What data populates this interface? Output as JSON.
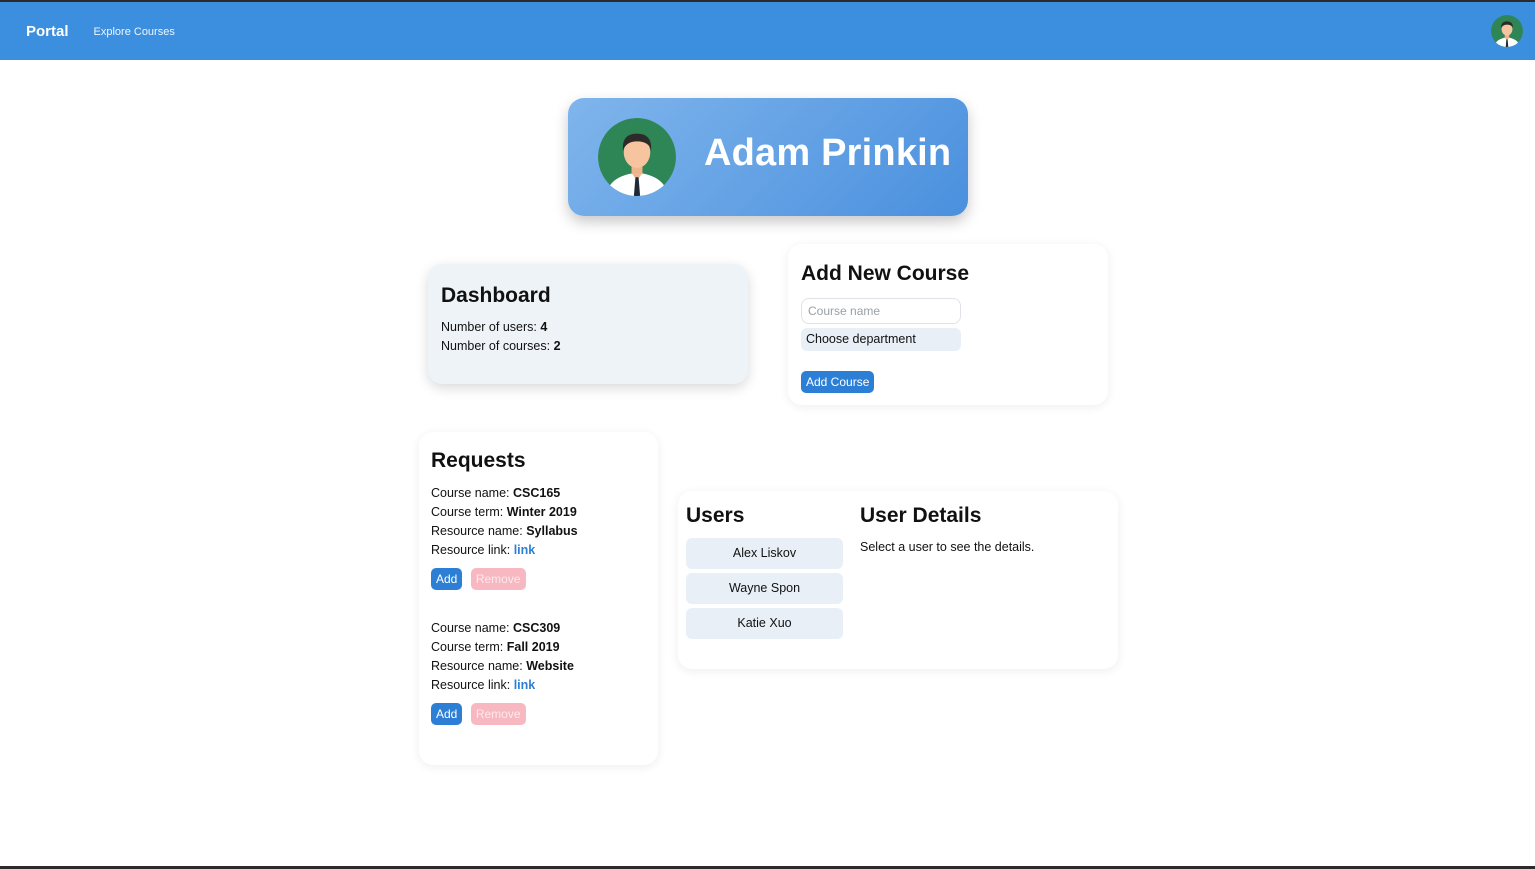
{
  "nav": {
    "brand": "Portal",
    "links": [
      "Explore Courses"
    ],
    "avatar_icon": "user-avatar-icon"
  },
  "profile": {
    "name": "Adam Prinkin",
    "avatar_icon": "user-avatar-icon"
  },
  "dashboard": {
    "title": "Dashboard",
    "users_label": "Number of users:",
    "users_count": "4",
    "courses_label": "Number of courses:",
    "courses_count": "2"
  },
  "add_course": {
    "title": "Add New Course",
    "course_name_placeholder": "Course name",
    "course_name_value": "",
    "department_label": "Choose department",
    "submit_label": "Add Course"
  },
  "requests": {
    "title": "Requests",
    "labels": {
      "course_name": "Course name:",
      "course_term": "Course term:",
      "resource_name": "Resource name:",
      "resource_link": "Resource link:"
    },
    "items": [
      {
        "course_name": "CSC165",
        "course_term": "Winter 2019",
        "resource_name": "Syllabus",
        "resource_link": "link",
        "add_label": "Add",
        "remove_label": "Remove"
      },
      {
        "course_name": "CSC309",
        "course_term": "Fall 2019",
        "resource_name": "Website",
        "resource_link": "link",
        "add_label": "Add",
        "remove_label": "Remove"
      }
    ]
  },
  "users": {
    "title": "Users",
    "list": [
      "Alex Liskov",
      "Wayne Spon",
      "Katie Xuo"
    ],
    "details_title": "User Details",
    "details_empty": "Select a user to see the details."
  },
  "colors": {
    "navbar": "#3b8fde",
    "primary_button": "#2d7fd5",
    "danger_button": "#f7b8c1",
    "list_item_bg": "#e8eff6",
    "dashboard_bg": "#eef3f7"
  }
}
